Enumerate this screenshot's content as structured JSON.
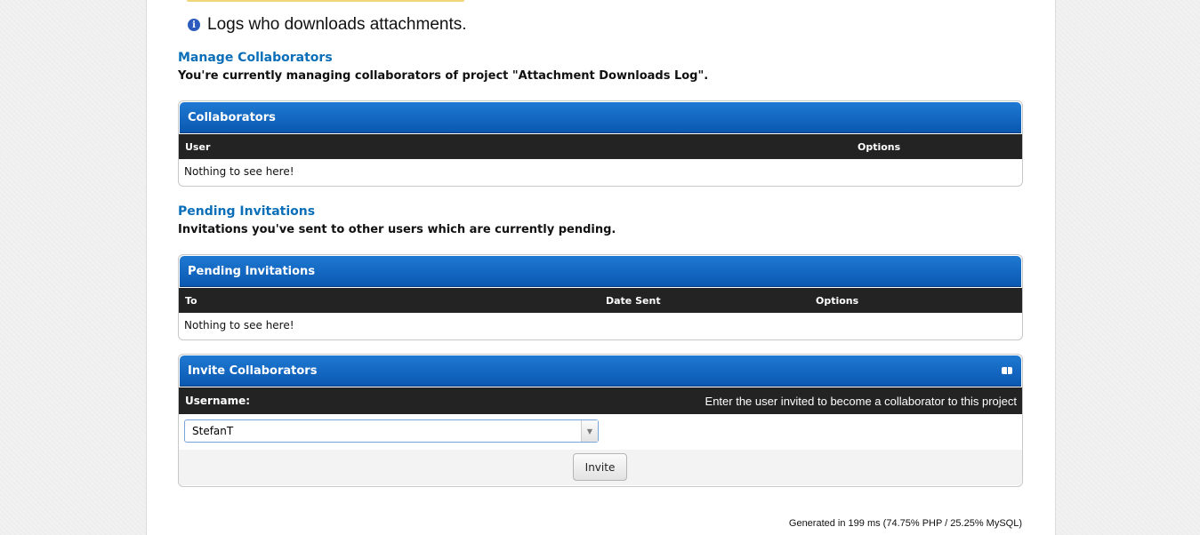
{
  "description": "Logs who downloads attachments.",
  "manage": {
    "title": "Manage Collaborators",
    "subtitle": "You're currently managing collaborators of project \"Attachment Downloads Log\"."
  },
  "collaborators_table": {
    "title": "Collaborators",
    "columns": [
      "User",
      "Options"
    ],
    "empty_text": "Nothing to see here!"
  },
  "pending": {
    "title": "Pending Invitations",
    "subtitle": "Invitations you've sent to other users which are currently pending."
  },
  "pending_table": {
    "title": "Pending Invitations",
    "columns": [
      "To",
      "Date Sent",
      "Options"
    ],
    "empty_text": "Nothing to see here!"
  },
  "invite": {
    "title": "Invite Collaborators",
    "username_label": "Username:",
    "hint": "Enter the user invited to become a collaborator to this project",
    "selected_user": "StefanT",
    "button_label": "Invite"
  },
  "footer": {
    "generated": "Generated in 199 ms (74.75% PHP / 25.25% MySQL)"
  }
}
